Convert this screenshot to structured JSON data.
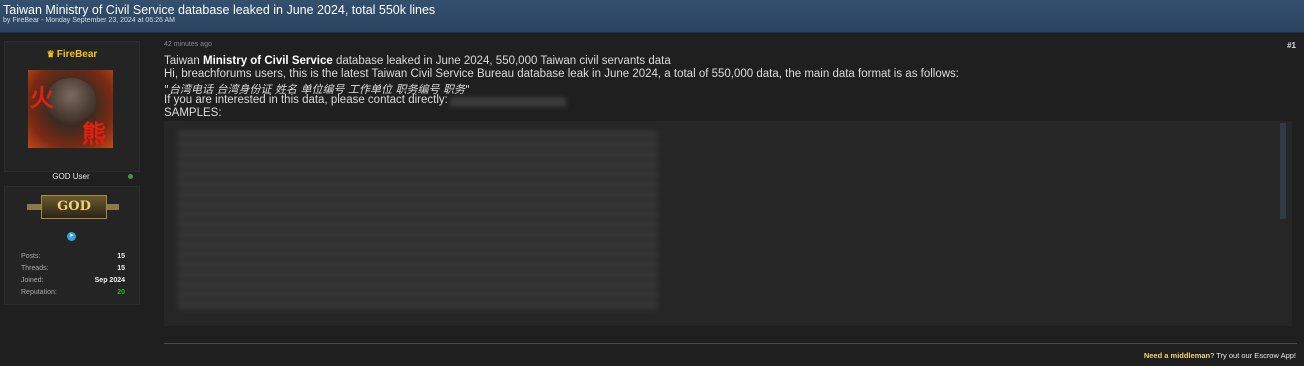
{
  "thread": {
    "title": "Taiwan Ministry of Civil Service database leaked in June 2024, total 550k lines",
    "meta": "by FireBear - Monday September 23, 2024 at 06:26 AM"
  },
  "user": {
    "username": "FireBear",
    "crown_icon": "crown-icon",
    "avatar_chars": [
      "火",
      "熊"
    ],
    "role": "GOD User",
    "badge": "GOD",
    "social_icon": "telegram-icon",
    "stats": [
      {
        "label": "Posts:",
        "value": "15"
      },
      {
        "label": "Threads:",
        "value": "15"
      },
      {
        "label": "Joined:",
        "value": "Sep 2024"
      },
      {
        "label": "Reputation:",
        "value": "20"
      }
    ],
    "reputation_color": "#2bb02b"
  },
  "post": {
    "time": "42 minutes ago",
    "number": "#1",
    "line1_prefix": "Taiwan ",
    "line1_bold": "Ministry of Civil Service",
    "line1_suffix": " database leaked in June 2024, 550,000 Taiwan civil servants data",
    "line2": "Hi, breachforums users, this is the latest Taiwan Civil Service Bureau database leak in June 2024, a total of 550,000 data, the main data format is as follows:",
    "line3": "\"台湾电话 台湾身份证 姓名 单位编号 工作单位 职务编号 职务\"",
    "line4": "If you are interested in this data, please contact directly:",
    "line5": "SAMPLES:"
  },
  "footer": {
    "bold": "Need a middleman",
    "rest": "? Try out our Escrow App!"
  },
  "colors": {
    "header_bg": "#2f4a68",
    "page_bg": "#1f1f1f",
    "username": "#f3c21a"
  }
}
